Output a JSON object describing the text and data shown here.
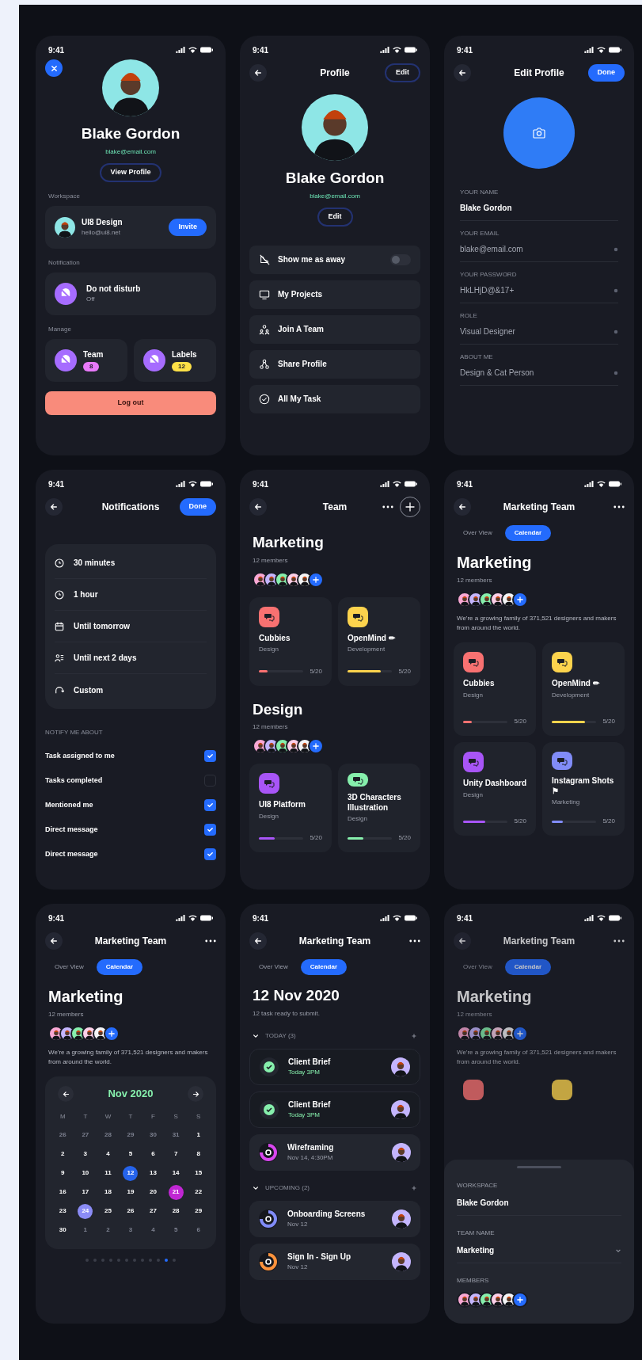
{
  "screens": [
    {
      "kind": "account",
      "time": "9:41",
      "name": "Blake Gordon",
      "email": "blake@email.com",
      "view_button": "View Profile",
      "workspace": {
        "label": "Workspace",
        "title": "UI8 Design",
        "subtitle": "hello@ui8.net",
        "button": "Invite"
      },
      "notification": {
        "label": "Notification",
        "title": "Do not disturb",
        "subtitle": "Off"
      },
      "manage": {
        "label": "Manage",
        "items": [
          {
            "title": "Team",
            "badge": "8",
            "color": "#e879f9"
          },
          {
            "title": "Labels",
            "badge": "12",
            "color": "#fde047"
          }
        ]
      },
      "logout": "Log out"
    },
    {
      "kind": "profile",
      "time": "9:41",
      "title": "Profile",
      "edit_top": "Edit",
      "name": "Blake Gordon",
      "email": "blake@email.com",
      "edit_button": "Edit",
      "menu": [
        {
          "label": "Show me as away",
          "kind": "toggle",
          "on": false
        },
        {
          "label": "My Projects",
          "kind": "link"
        },
        {
          "label": "Join A Team",
          "kind": "link"
        },
        {
          "label": "Share Profile",
          "kind": "link"
        },
        {
          "label": "All My Task",
          "kind": "link"
        }
      ]
    },
    {
      "kind": "edit_profile",
      "time": "9:41",
      "title": "Edit Profile",
      "done": "Done",
      "fields": [
        {
          "label": "YOUR NAME",
          "value": "Blake Gordon",
          "focused": true
        },
        {
          "label": "YOUR EMAIL",
          "value": "blake@email.com",
          "focused": false
        },
        {
          "label": "YOUR PASSWORD",
          "value": "HkLHjD@&17+",
          "focused": false
        },
        {
          "label": "ROLE",
          "value": "Visual Designer",
          "focused": false
        },
        {
          "label": "ABOUT ME",
          "value": "Design & Cat Person",
          "focused": false
        }
      ]
    },
    {
      "kind": "notifications",
      "time": "9:41",
      "title": "Notifications",
      "done": "Done",
      "options": [
        {
          "label": "30 minutes"
        },
        {
          "label": "1 hour"
        },
        {
          "label": "Until tomorrow"
        },
        {
          "label": "Until next 2 days"
        },
        {
          "label": "Custom"
        }
      ],
      "section": "NOTIFY ME ABOUT",
      "toggles": [
        {
          "label": "Task assigned to me",
          "checked": true
        },
        {
          "label": "Tasks completed",
          "checked": false
        },
        {
          "label": "Mentioned me",
          "checked": true
        },
        {
          "label": "Direct message",
          "checked": true
        },
        {
          "label": "Direct message",
          "checked": true
        }
      ]
    },
    {
      "kind": "team",
      "time": "9:41",
      "title": "Team",
      "groups": [
        {
          "name": "Marketing",
          "members": "12 members",
          "projects": [
            {
              "name": "Cubbies",
              "category": "Design",
              "level": 0.2,
              "count": "5/20",
              "color": "#f87171"
            },
            {
              "name": "OpenMind ✏",
              "category": "Development",
              "level": 0.75,
              "count": "5/20",
              "color": "#fcd34d"
            }
          ]
        },
        {
          "name": "Design",
          "members": "12 members",
          "projects": [
            {
              "name": "UI8 Platform",
              "category": "Design",
              "level": 0.35,
              "count": "5/20",
              "color": "#a855f7"
            },
            {
              "name": "3D Characters Illustration",
              "category": "Design",
              "level": 0.35,
              "count": "5/20",
              "color": "#86efac"
            }
          ]
        }
      ]
    },
    {
      "kind": "team_overview",
      "time": "9:41",
      "title": "Marketing Team",
      "tabs": [
        {
          "label": "Over View",
          "selected": false
        },
        {
          "label": "Calendar",
          "selected": true
        }
      ],
      "heading": "Marketing",
      "members": "12 members",
      "description": "We're a growing family of 371,521 designers and makers from around the world.",
      "projects": [
        {
          "name": "Cubbies",
          "category": "Design",
          "level": 0.2,
          "count": "5/20",
          "color": "#f87171"
        },
        {
          "name": "OpenMind ✏",
          "category": "Development",
          "level": 0.75,
          "count": "5/20",
          "color": "#fcd34d"
        },
        {
          "name": "Unity Dashboard",
          "category": "Design",
          "level": 0.5,
          "count": "5/20",
          "color": "#a855f7"
        },
        {
          "name": "Instagram Shots ⚑",
          "category": "Marketing",
          "level": 0.25,
          "count": "5/20",
          "color": "#818cf8"
        }
      ]
    },
    {
      "kind": "team_calendar",
      "time": "9:41",
      "title": "Marketing Team",
      "tabs": [
        {
          "label": "Over View",
          "selected": false
        },
        {
          "label": "Calendar",
          "selected": true
        }
      ],
      "heading": "Marketing",
      "members": "12 members",
      "description": "We're a growing family of 371,521 designers and makers from around the world.",
      "calendar": {
        "month": "Nov 2020",
        "weekdays": [
          "M",
          "T",
          "W",
          "T",
          "F",
          "S",
          "S"
        ],
        "days": [
          {
            "label": "26",
            "muted": true
          },
          {
            "label": "27",
            "muted": true
          },
          {
            "label": "28",
            "muted": true
          },
          {
            "label": "29",
            "muted": true
          },
          {
            "label": "30",
            "muted": true
          },
          {
            "label": "31",
            "muted": true
          },
          {
            "label": "1",
            "muted": false
          },
          {
            "label": "2",
            "muted": false
          },
          {
            "label": "3",
            "muted": false
          },
          {
            "label": "4",
            "muted": false
          },
          {
            "label": "5",
            "muted": false
          },
          {
            "label": "6",
            "muted": false
          },
          {
            "label": "7",
            "muted": false
          },
          {
            "label": "8",
            "muted": false
          },
          {
            "label": "9",
            "muted": false
          },
          {
            "label": "10",
            "muted": false
          },
          {
            "label": "11",
            "muted": false
          },
          {
            "label": "12",
            "muted": false,
            "color": "#2563eb"
          },
          {
            "label": "13",
            "muted": false
          },
          {
            "label": "14",
            "muted": false
          },
          {
            "label": "15",
            "muted": false
          },
          {
            "label": "16",
            "muted": false
          },
          {
            "label": "17",
            "muted": false
          },
          {
            "label": "18",
            "muted": false
          },
          {
            "label": "19",
            "muted": false
          },
          {
            "label": "20",
            "muted": false
          },
          {
            "label": "21",
            "muted": false,
            "color": "#c026d3"
          },
          {
            "label": "22",
            "muted": false
          },
          {
            "label": "23",
            "muted": false
          },
          {
            "label": "24",
            "muted": false,
            "color": "#8b8cf6"
          },
          {
            "label": "25",
            "muted": false
          },
          {
            "label": "26",
            "muted": false
          },
          {
            "label": "27",
            "muted": false
          },
          {
            "label": "28",
            "muted": false
          },
          {
            "label": "29",
            "muted": false
          },
          {
            "label": "30",
            "muted": false
          },
          {
            "label": "1",
            "muted": true
          },
          {
            "label": "2",
            "muted": true
          },
          {
            "label": "3",
            "muted": true
          },
          {
            "label": "4",
            "muted": true
          },
          {
            "label": "5",
            "muted": true
          },
          {
            "label": "6",
            "muted": true
          }
        ]
      },
      "pager": [
        {
          "selected": false
        },
        {
          "selected": false
        },
        {
          "selected": false
        },
        {
          "selected": false
        },
        {
          "selected": false
        },
        {
          "selected": false
        },
        {
          "selected": false
        },
        {
          "selected": false
        },
        {
          "selected": false
        },
        {
          "selected": false
        },
        {
          "selected": true
        },
        {
          "selected": false
        }
      ]
    },
    {
      "kind": "day_tasks",
      "time": "9:41",
      "title": "Marketing Team",
      "tabs": [
        {
          "label": "Over View",
          "selected": false
        },
        {
          "label": "Calendar",
          "selected": true
        }
      ],
      "heading": "12 Nov 2020",
      "subtitle": "12 task ready to submit.",
      "groups": [
        {
          "label": "TODAY (3)",
          "tasks": [
            {
              "title": "Client Brief",
              "time": "Today 3PM",
              "kind": "done",
              "color": "#86efac"
            },
            {
              "title": "Client Brief",
              "time": "Today 3PM",
              "kind": "done",
              "color": "#86efac"
            },
            {
              "title": "Wireframing",
              "time": "Nov 14, 4:30PM",
              "kind": "progress",
              "color": "#d946ef"
            }
          ]
        },
        {
          "label": "UPCOMING (2)",
          "tasks": [
            {
              "title": "Onboarding Screens",
              "time": "Nov 12",
              "kind": "progress",
              "color": "#818cf8"
            },
            {
              "title": "Sign In - Sign Up",
              "time": "Nov 12",
              "kind": "progress",
              "color": "#fb923c"
            }
          ]
        }
      ]
    },
    {
      "kind": "team_sheet",
      "time": "9:41",
      "title": "Marketing Team",
      "tabs": [
        {
          "label": "Over View",
          "selected": false
        },
        {
          "label": "Calendar",
          "selected": true
        }
      ],
      "heading": "Marketing",
      "members": "12 members",
      "description": "We're a growing family of 371,521 designers and makers from around the world.",
      "sheet": {
        "fields": [
          {
            "label": "WORKSPACE",
            "value": "Blake Gordon",
            "kind": "text"
          },
          {
            "label": "TEAM NAME",
            "value": "Marketing",
            "kind": "select"
          }
        ],
        "members_label": "MEMBERS"
      }
    }
  ]
}
